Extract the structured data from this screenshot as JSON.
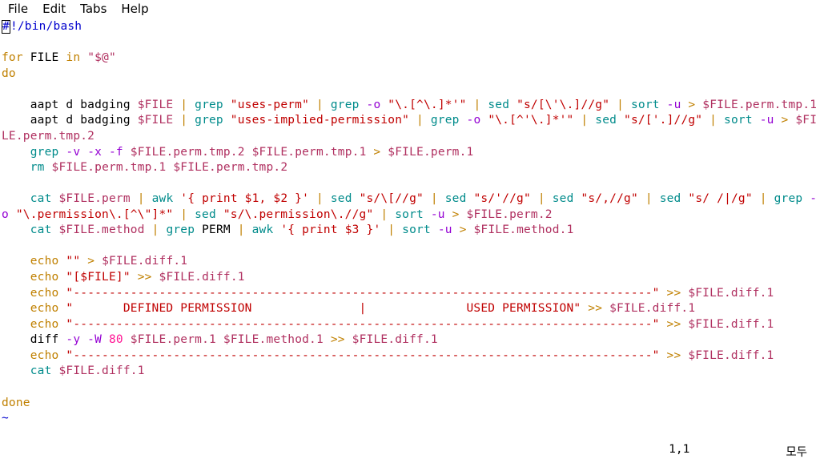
{
  "menu": {
    "file": "File",
    "edit": "Edit",
    "tabs": "Tabs",
    "help": "Help"
  },
  "code": {
    "shebang_hash": "#",
    "shebang_rest": "!/bin/bash",
    "l3_for": "for",
    "l3_file": " FILE ",
    "l3_in": "in",
    "l3_arg": " \"$@\"",
    "l4_do": "do",
    "l6_pre": "    aapt d badging ",
    "l6_v1": "$FILE",
    "l6_p1": " | ",
    "l6_grep": "grep",
    "l6_s1": " \"uses-perm\"",
    "l6_p2": " | ",
    "l6_grep2": "grep",
    "l6_o": " -o",
    "l6_s2": " \"\\.[^\\.]*'\"",
    "l6_p3": " | ",
    "l6_sed": "sed",
    "l6_s3": " \"s/[\\'\\.]//g\"",
    "l6_p4": " | ",
    "l6_sort": "sort",
    "l6_u": " -u",
    "l6_gt": " > ",
    "l6_v2": "$FILE",
    "l6_tail": ".perm.tmp.1",
    "l7_pre": "    aapt d badging ",
    "l7_v1": "$FILE",
    "l7_p1": " | ",
    "l7_grep": "grep",
    "l7_s1": " \"uses-implied-permission\"",
    "l7_p2": " | ",
    "l7_grep2": "grep",
    "l7_o": " -o",
    "l7_s2": " \"\\.[^'\\.]*'\"",
    "l7_p3": " | ",
    "l7_sed": "sed",
    "l7_s3": " \"s/['.]//g\"",
    "l7_p4": " | ",
    "l7_sort": "sort",
    "l7_u": " -u",
    "l7_gt": " > ",
    "l7_v2": "$FILE",
    "l7_tail": ".perm.tmp.2",
    "l8_pre": "    ",
    "l8_grep": "grep",
    "l8_opts": " -v -x -f",
    "l8_sp": " ",
    "l8_v1": "$FILE",
    "l8_t1": ".perm.tmp.2 ",
    "l8_v2": "$FILE",
    "l8_t2": ".perm.tmp.1",
    "l8_gt": " > ",
    "l8_v3": "$FILE",
    "l8_t3": ".perm.1",
    "l9_pre": "    ",
    "l9_rm": "rm",
    "l9_sp": " ",
    "l9_v1": "$FILE",
    "l9_t1": ".perm.tmp.1 ",
    "l9_v2": "$FILE",
    "l9_t2": ".perm.tmp.2",
    "l11_pre": "    ",
    "l11_cat": "cat",
    "l11_sp": " ",
    "l11_v1": "$FILE",
    "l11_t1": ".perm",
    "l11_p1": " | ",
    "l11_awk": "awk",
    "l11_s1": " '{ print $1, $2 }'",
    "l11_p2": " | ",
    "l11_sed1": "sed",
    "l11_s2": " \"s/\\[//g\"",
    "l11_p3": " | ",
    "l11_sed2": "sed",
    "l11_s3": " \"s/'//g\"",
    "l11_p4": " | ",
    "l11_sed3": "sed",
    "l11_s4": " \"s/,//g\"",
    "l11_p5": " | ",
    "l11_sed4": "sed",
    "l11_s5": " \"s/ /|/g\"",
    "l11b_p": " | ",
    "l11b_grep": "grep",
    "l11b_o": " -o",
    "l11b_s": " \"\\.permission\\.[^\\\"]*\"",
    "l11b_p2": " | ",
    "l11b_sed": "sed",
    "l11b_s2": " \"s/\\.permission\\.//g\"",
    "l11b_p3": " | ",
    "l11b_sort": "sort",
    "l11b_u": " -u",
    "l11b_gt": " > ",
    "l11b_v": "$FILE",
    "l11b_t": ".perm.2",
    "l12_pre": "    ",
    "l12_cat": "cat",
    "l12_sp": " ",
    "l12_v1": "$FILE",
    "l12_t1": ".method",
    "l12_p1": " | ",
    "l12_grep": "grep",
    "l12_perm": " PERM",
    "l12_p2": " | ",
    "l12_awk": "awk",
    "l12_s1": " '{ print $3 }'",
    "l12_p3": " | ",
    "l12_sort": "sort",
    "l12_u": " -u",
    "l12_gt": " > ",
    "l12_v2": "$FILE",
    "l12_t2": ".method.1",
    "e1_pre": "    ",
    "e1_echo": "echo",
    "e1_s": " \"\"",
    "e1_gt": " > ",
    "e1_v": "$FILE",
    "e1_t": ".diff.1",
    "e2_pre": "    ",
    "e2_echo": "echo",
    "e2_s": " \"[$FILE]\"",
    "e2_gt": " >> ",
    "e2_v": "$FILE",
    "e2_t": ".diff.1",
    "e3_pre": "    ",
    "e3_echo": "echo",
    "e3_s": " \"---------------------------------------------------------------------------------\"",
    "e3_gt": " >> ",
    "e3_v": "$FILE",
    "e3_t": ".diff.1",
    "e4_pre": "    ",
    "e4_echo": "echo",
    "e4_s": " \"       DEFINED PERMISSION               |              USED PERMISSION\"",
    "e4_gt": " >> ",
    "e4_v": "$FILE",
    "e4_t": ".diff.1",
    "e5_pre": "    ",
    "e5_echo": "echo",
    "e5_s": " \"---------------------------------------------------------------------------------\"",
    "e5_gt": " >> ",
    "e5_v": "$FILE",
    "e5_t": ".diff.1",
    "d_pre": "    diff ",
    "d_opts": "-y -W",
    "d_num": " 80",
    "d_sp": " ",
    "d_v1": "$FILE",
    "d_t1": ".perm.1 ",
    "d_v2": "$FILE",
    "d_t2": ".method.1",
    "d_gt": " >> ",
    "d_v3": "$FILE",
    "d_t3": ".diff.1",
    "e6_pre": "    ",
    "e6_echo": "echo",
    "e6_s": " \"---------------------------------------------------------------------------------\"",
    "e6_gt": " >> ",
    "e6_v": "$FILE",
    "e6_t": ".diff.1",
    "c_pre": "    ",
    "c_cat": "cat",
    "c_sp": " ",
    "c_v": "$FILE",
    "c_t": ".diff.1",
    "done": "done",
    "tilde": "~"
  },
  "status": {
    "pos": "1,1",
    "mode": "모두"
  }
}
